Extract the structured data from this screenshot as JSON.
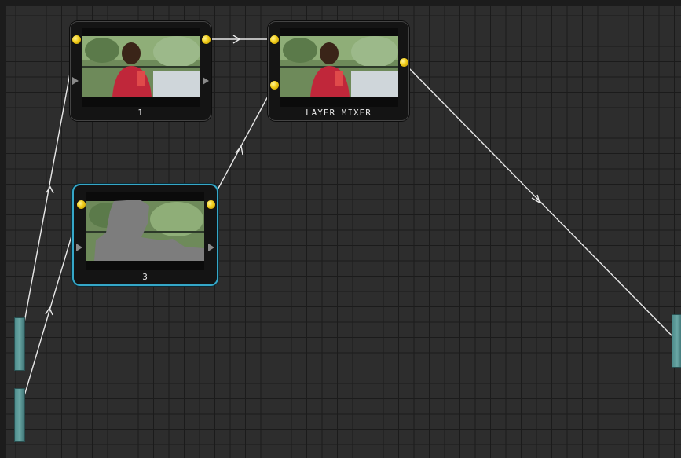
{
  "nodes": [
    {
      "label": "1",
      "selected": false
    },
    {
      "label": "LAYER MIXER",
      "selected": false
    },
    {
      "label": "3",
      "selected": true
    }
  ],
  "colors": {
    "grid_background": "#2d2d2d",
    "grid_lines": "#1b1b1b",
    "node_body": "#141414",
    "selected_outline": "#35a7c8",
    "port": "#f2cd18",
    "link": "#e8e8e8",
    "external_port": "#6aa7a5"
  },
  "icons": {
    "port": "yellow-dot-icon",
    "arrow": "arrow-head-icon",
    "pass_through": "triangle-right-icon"
  }
}
